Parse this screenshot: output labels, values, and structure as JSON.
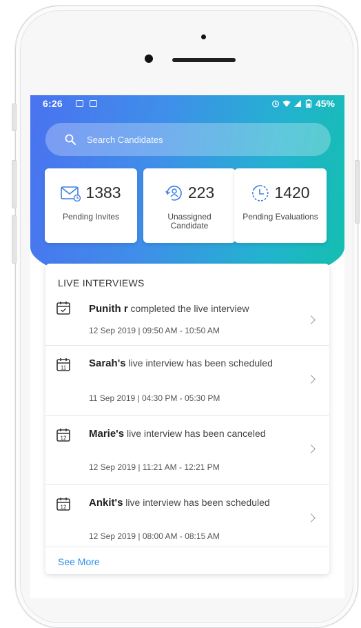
{
  "status_bar": {
    "time": "6:26",
    "battery": "45%"
  },
  "search": {
    "placeholder": "Search Candidates"
  },
  "stats": [
    {
      "value": "1383",
      "label": "Pending Invites",
      "icon": "envelope-icon"
    },
    {
      "value": "223",
      "label": "Unassigned Candidate",
      "icon": "refresh-user-icon"
    },
    {
      "value": "1420",
      "label": "Pending Evaluations",
      "icon": "clock-icon"
    }
  ],
  "live": {
    "title": "LIVE INTERVIEWS",
    "items": [
      {
        "name": "Punith r",
        "message": " completed the live interview",
        "time": "12 Sep 2019 | 09:50 AM - 10:50 AM",
        "cal_day": "✓"
      },
      {
        "name": "Sarah's",
        "message": " live interview has been scheduled",
        "time": "11 Sep 2019 | 04:30 PM - 05:30 PM",
        "cal_day": "11"
      },
      {
        "name": "Marie's",
        "message": " live interview has been canceled",
        "time": "12 Sep 2019 | 11:21 AM - 12:21 PM",
        "cal_day": "12"
      },
      {
        "name": "Ankit's",
        "message": " live interview has been scheduled",
        "time": "12 Sep 2019 | 08:00 AM - 08:15 AM",
        "cal_day": "12"
      }
    ],
    "see_more": "See More"
  },
  "colors": {
    "gradient_start": "#4a72f0",
    "gradient_end": "#13bfae",
    "link": "#2d8ee8"
  }
}
